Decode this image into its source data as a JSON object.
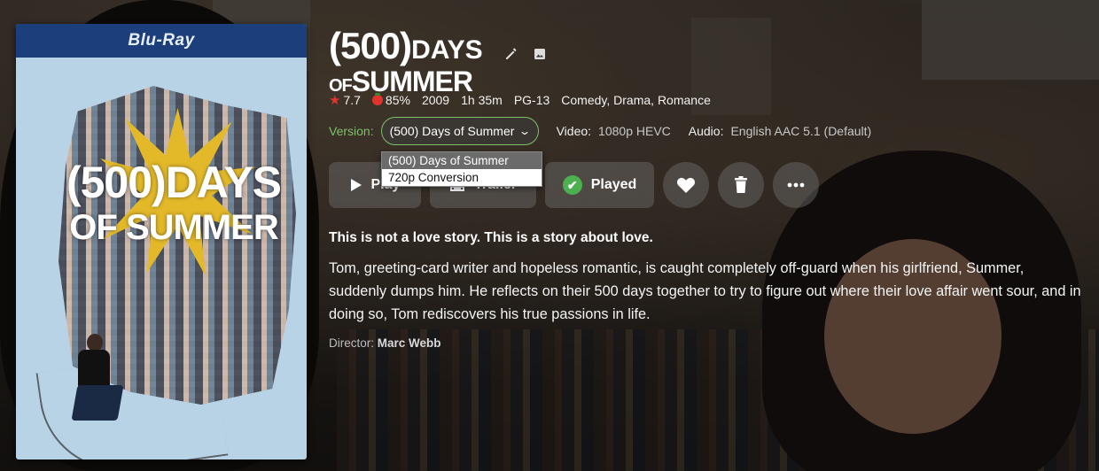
{
  "poster": {
    "format_label": "Blu-Ray",
    "title_line1": "(500)DAYS",
    "title_line2": "OF SUMMER"
  },
  "title_logo": {
    "line1_big": "(500)",
    "line1_small": "DAYS",
    "line2_small": "OF",
    "line2_big": "SUMMER"
  },
  "title_icons": [
    "edit-pencil-icon",
    "image-icon"
  ],
  "meta": {
    "rating": "7.7",
    "critic_score": "85%",
    "year": "2009",
    "runtime": "1h 35m",
    "certification": "PG-13",
    "genres": "Comedy, Drama, Romance"
  },
  "version": {
    "label": "Version:",
    "selected": "(500) Days of Summer",
    "options": [
      "(500) Days of Summer",
      "720p Conversion"
    ],
    "highlighted_index": 1
  },
  "video": {
    "label": "Video:",
    "value": "1080p HEVC"
  },
  "audio": {
    "label": "Audio:",
    "value": "English AAC 5.1 (Default)"
  },
  "buttons": {
    "play": "Play",
    "trailer": "Trailer",
    "played": "Played",
    "favorite_icon": "heart-icon",
    "delete_icon": "trash-icon",
    "more_icon": "more-horizontal-icon"
  },
  "tagline": "This is not a love story. This is a story about love.",
  "overview": "Tom, greeting-card writer and hopeless romantic, is caught completely off-guard when his girlfriend, Summer, suddenly dumps him. He reflects on their 500 days together to try to figure out where their love affair went sour, and in doing so, Tom rediscovers his true passions in life.",
  "director": {
    "label": "Director:",
    "name": "Marc Webb"
  },
  "colors": {
    "accent_green": "#7fc06a",
    "played_check": "#4caf50",
    "rating_star": "#e0342d",
    "bluray_bar": "#1c3f7c"
  }
}
